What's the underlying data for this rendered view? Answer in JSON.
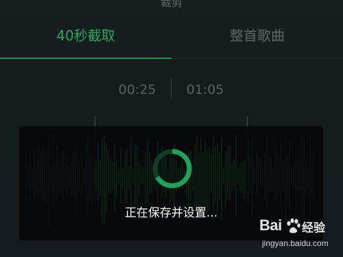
{
  "header": {
    "title": "裁剪"
  },
  "tabs": [
    {
      "label": "40秒截取",
      "active": true
    },
    {
      "label": "整首歌曲",
      "active": false
    }
  ],
  "time_range": {
    "start": "00:25",
    "end": "01:05"
  },
  "dialog": {
    "message": "正在保存并设置..."
  },
  "watermark": {
    "logo": "Baidu",
    "brand": "经验",
    "url": "jingyan.baidu.com"
  },
  "colors": {
    "accent": "#2aa75f",
    "inactive_text": "#5e6868",
    "background": "#141b1d",
    "dialog_bg": "#060809"
  },
  "icons": {
    "spinner": "loading-spinner-icon",
    "paw": "baidu-paw-icon"
  }
}
